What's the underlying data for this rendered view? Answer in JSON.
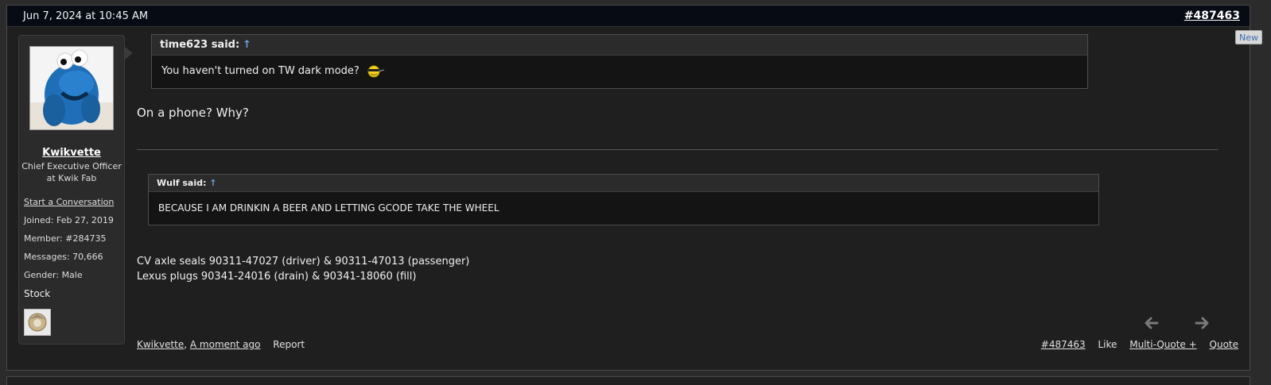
{
  "post": {
    "date": "Jun 7, 2024 at 10:45 AM",
    "permalink": "#487463",
    "new_badge": "New"
  },
  "user": {
    "name": "Kwikvette",
    "title_line1": "Chief Executive Officer",
    "title_line2": "at Kwik Fab",
    "start_conversation": "Start a Conversation",
    "joined_label": "Joined:",
    "joined_value": "Feb 27, 2019",
    "member_label": "Member:",
    "member_value": "#284735",
    "messages_label": "Messages:",
    "messages_value": "70,666",
    "gender_label": "Gender:",
    "gender_value": "Male",
    "stock": "Stock"
  },
  "quote1": {
    "author": "time623 said:",
    "arrow": "↑",
    "text": "You haven't turned on TW dark mode?"
  },
  "reply1": "On a phone? Why?",
  "quote2": {
    "author": "Wulf said:",
    "arrow": "↑",
    "text": "BECAUSE I AM DRINKIN A BEER AND LETTING GCODE TAKE THE WHEEL"
  },
  "signature": {
    "line1": "CV axle seals 90311-47027 (driver) & 90311-47013 (passenger)",
    "line2": "Lexus plugs 90341-24016 (drain) & 90341-18060 (fill)"
  },
  "footer": {
    "author": "Kwikvette",
    "time": "A moment ago",
    "report": "Report",
    "post_number": "#487463",
    "like": "Like",
    "multiquote": "Multi-Quote +",
    "quote": "Quote"
  }
}
